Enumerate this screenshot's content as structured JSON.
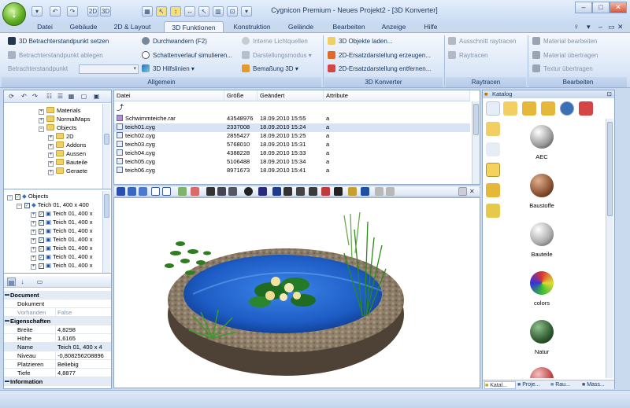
{
  "window": {
    "title": "Cygnicon Premium - Neues Projekt2 - [3D Konverter]",
    "controls": [
      "–",
      "□",
      "✕"
    ]
  },
  "quick_access": [
    "▾",
    "↶",
    "↷",
    "2D",
    "3D",
    "▦",
    "↖",
    "↕",
    "↔",
    "↖",
    "▥",
    "⊡",
    "▾"
  ],
  "menu_tabs": [
    "Datei",
    "Gebäude",
    "2D & Layout",
    "3D Funktionen",
    "Konstruktion",
    "Gelände",
    "Bearbeiten",
    "Anzeige",
    "Hilfe"
  ],
  "active_tab": "3D Funktionen",
  "ribbon": {
    "allgemein": {
      "label": "Allgemein",
      "buttons": {
        "set_viewpoint": "3D Betrachterstandpunkt setzen",
        "store_viewpoint": "Betrachterstandpunkt ablegen",
        "viewpoint_label": "Betrachterstandpunkt",
        "walkthrough": "Durchwandern (F2)",
        "shadow": "Schattenverlauf simulieren...",
        "helplines": "3D Hilfslinien",
        "lights": "Interne Lichtquellen",
        "display_mode": "Darstellungsmodus",
        "dimension": "Bemaßung 3D"
      }
    },
    "konverter": {
      "label": "3D Konverter",
      "buttons": {
        "load": "3D Objekte laden...",
        "create_2d": "2D-Ersatzdarstellung erzeugen...",
        "remove_2d": "2D-Ersatzdarstellung entfernen..."
      }
    },
    "raytracen": {
      "label": "Raytracen",
      "buttons": {
        "region": "Ausschnitt raytracen",
        "full": "Raytracen"
      }
    },
    "bearbeiten": {
      "label": "Bearbeiten",
      "buttons": {
        "edit_material": "Material bearbeiten",
        "transfer_material": "Material übertragen",
        "transfer_texture": "Textur übertragen"
      }
    }
  },
  "folder_tree": [
    "Materials",
    "NormalMaps",
    "Objects",
    "2D",
    "Addons",
    "Aussen",
    "Bauteile",
    "Geraete"
  ],
  "object_tree": {
    "root": "Objects",
    "items": [
      "Teich 01, 400 x 400",
      "Teich 01, 400 x",
      "Teich 01, 400 x",
      "Teich 01, 400 x",
      "Teich 01, 400 x",
      "Teich 01, 400 x",
      "Teich 01, 400 x",
      "Teich 01, 400 x"
    ]
  },
  "properties": {
    "cat_document": "Document",
    "rows_document": [
      {
        "k": "Dokument",
        "v": ""
      },
      {
        "k": "Vorhanden",
        "v": "False"
      }
    ],
    "cat_properties": "Eigenschaften",
    "rows_properties": [
      {
        "k": "Breite",
        "v": "4,8298"
      },
      {
        "k": "Höhe",
        "v": "1,6165"
      },
      {
        "k": "Name",
        "v": "Teich 01, 400 x 4"
      },
      {
        "k": "Niveau",
        "v": "-0,808256208896"
      },
      {
        "k": "Platzieren",
        "v": "Beliebig"
      },
      {
        "k": "Tiefe",
        "v": "4,8877"
      }
    ],
    "cat_info": "Information"
  },
  "file_list": {
    "headers": [
      "Datei",
      "Größe",
      "Geändert",
      "Attribute"
    ],
    "rows": [
      {
        "name": "Schwimmteiche.rar",
        "size": "43548976",
        "date": "18.09.2010 15:55",
        "attr": "a"
      },
      {
        "name": "teich01.cyg",
        "size": "2337008",
        "date": "18.09.2010 15:24",
        "attr": "a"
      },
      {
        "name": "teich02.cyg",
        "size": "2855427",
        "date": "18.09.2010 15:25",
        "attr": "a"
      },
      {
        "name": "teich03.cyg",
        "size": "5768010",
        "date": "18.09.2010 15:31",
        "attr": "a"
      },
      {
        "name": "teich04.cyg",
        "size": "4388228",
        "date": "18.09.2010 15:33",
        "attr": "a"
      },
      {
        "name": "teich05.cyg",
        "size": "5106488",
        "date": "18.09.2010 15:34",
        "attr": "a"
      },
      {
        "name": "teich06.cyg",
        "size": "8971673",
        "date": "18.09.2010 15:41",
        "attr": "a"
      }
    ]
  },
  "catalog": {
    "title": "Katalog",
    "items": [
      "AEC",
      "Baustoffe",
      "Bauteile",
      "colors",
      "Natur"
    ],
    "bottom_tabs": [
      "Katal...",
      "Proje...",
      "Rau...",
      "Mass..."
    ]
  },
  "colors": {
    "accent": "#3a6fb6",
    "ribbon_bg": "#dbe7f7",
    "water": "#1d5cc4",
    "rock": "#8a7a66"
  }
}
